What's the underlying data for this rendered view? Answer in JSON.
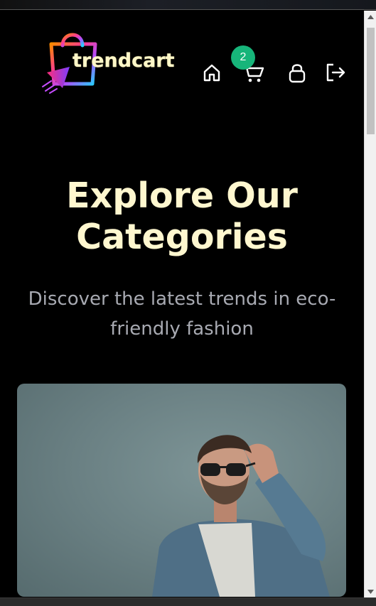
{
  "header": {
    "logo_text": "trendcart",
    "cart_count": "2",
    "nav": [
      "home-icon",
      "cart-icon",
      "lock-icon",
      "logout-icon"
    ]
  },
  "hero": {
    "title": "Explore Our Categories",
    "subtitle": "Discover the latest trends in eco-friendly fashion"
  },
  "colors": {
    "background": "#000000",
    "title": "#fff7cf",
    "subtitle": "#a8aab2",
    "badge": "#17b57a"
  }
}
